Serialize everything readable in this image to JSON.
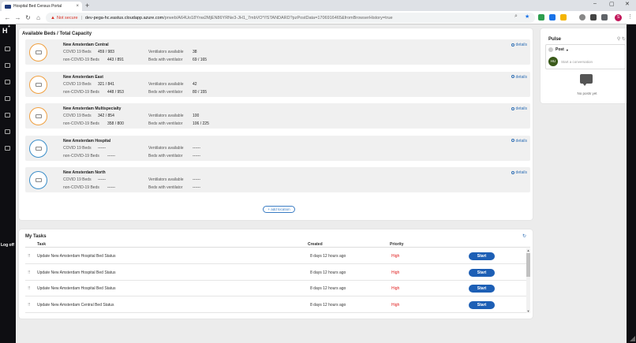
{
  "browser": {
    "tab_title": "Hospital Bed Census Portal",
    "not_secure": "Not secure",
    "url_host": "dev-pega-hc.eastus.cloudapp.azure.com",
    "url_path": "/prweb/A64Uo18Ynw2MjEN86YRNe3-JH1_7mbVO*/!STANDARD?pzPostData=1706916465&fromBrowserHistory=true",
    "profile_initial": "S"
  },
  "app": {
    "logo": "H",
    "logoff_label": "Log off"
  },
  "beds": {
    "title": "Available Beds / Total Capacity",
    "labels": {
      "covid": "COVID 19 Beds",
      "noncovid": "non-COVID-19 Beds",
      "vent": "Ventilators available",
      "bedsvent": "Beds with ventilator",
      "details": "details"
    },
    "add_location": "+ add location",
    "locations": [
      {
        "name": "New Amsterdam Central",
        "covid": "459 / 983",
        "noncovid": "443 / 891",
        "vent": "38",
        "bedsvent": "69 / 165",
        "ring_color": "#f0a040"
      },
      {
        "name": "New Amsterdam East",
        "covid": "321 / 841",
        "noncovid": "448 / 953",
        "vent": "42",
        "bedsvent": "80 / 155",
        "ring_color": "#f0a040"
      },
      {
        "name": "New Amsterdam Multispecialty",
        "covid": "342 / 854",
        "noncovid": "358 / 800",
        "vent": "100",
        "bedsvent": "106 / 225",
        "ring_color": "#f0a040"
      },
      {
        "name": "New Amsterdam Hospital",
        "covid": "------",
        "noncovid": "------",
        "vent": "------",
        "bedsvent": "------",
        "ring_color": "#3b8ec9"
      },
      {
        "name": "New Amsterdam North",
        "covid": "------",
        "noncovid": "------",
        "vent": "------",
        "bedsvent": "------",
        "ring_color": "#3b8ec9"
      }
    ]
  },
  "pulse": {
    "title": "Pulse",
    "post_type": "Post",
    "avatar_initials": "HU",
    "placeholder": "Start a conversation",
    "no_posts": "No posts yet"
  },
  "tasks": {
    "title": "My Tasks",
    "columns": {
      "task": "Task",
      "created": "Created",
      "priority": "Priority"
    },
    "start_label": "Start",
    "rows": [
      {
        "task": "Update New Amsterdam Hospital Bed Status",
        "created": "8 days 12 hours ago",
        "priority": "High"
      },
      {
        "task": "Update New Amsterdam Hospital Bed Status",
        "created": "8 days 12 hours ago",
        "priority": "High"
      },
      {
        "task": "Update New Amsterdam Hospital Bed Status",
        "created": "8 days 12 hours ago",
        "priority": "High"
      },
      {
        "task": "Update New Amsterdam Central Bed Status",
        "created": "8 days 12 hours ago",
        "priority": "High"
      }
    ]
  }
}
